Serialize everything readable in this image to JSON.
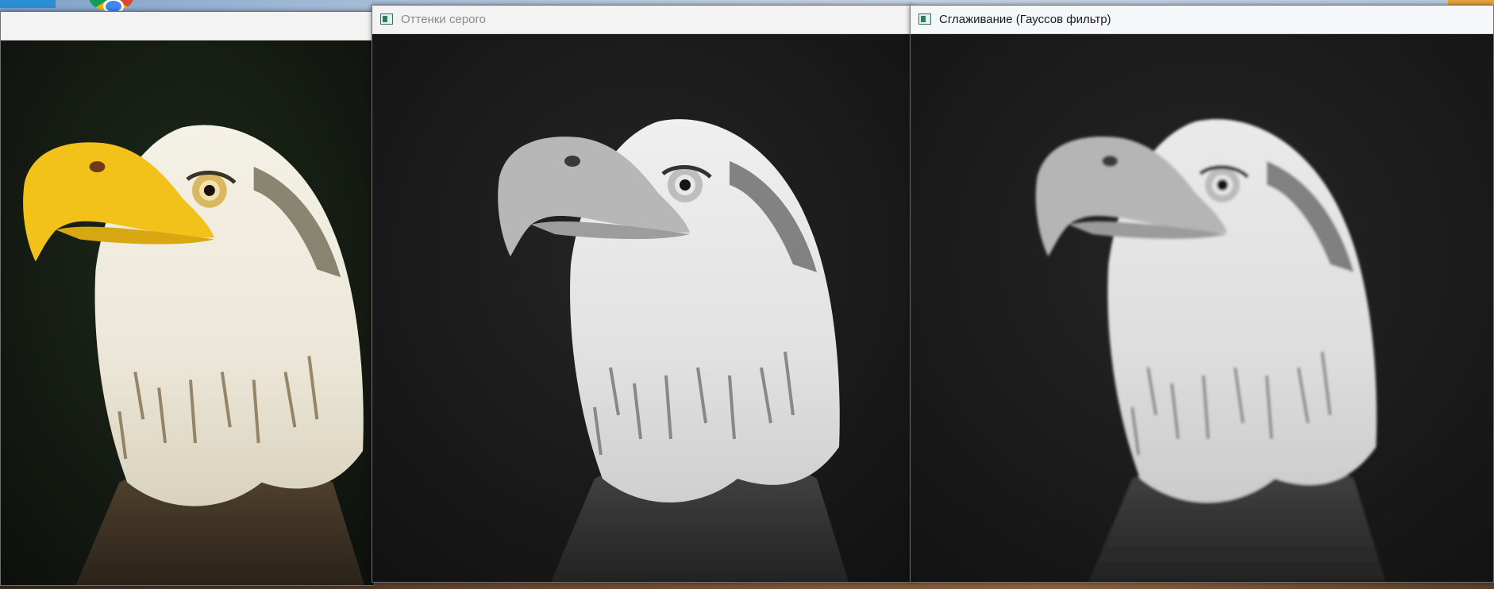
{
  "windows": {
    "original": {
      "title": "",
      "image_kind": "color"
    },
    "grayscale": {
      "title": "Оттенки серого",
      "image_kind": "grayscale"
    },
    "gaussian": {
      "title": "Сглаживание (Гауссов фильтр)",
      "image_kind": "grayscale-blurred"
    }
  },
  "icons": {
    "app_icon": "opencv-window-icon",
    "browser": "chrome-icon"
  },
  "colors": {
    "beak_color": "#f2c21a",
    "background_dark": "#151515"
  }
}
